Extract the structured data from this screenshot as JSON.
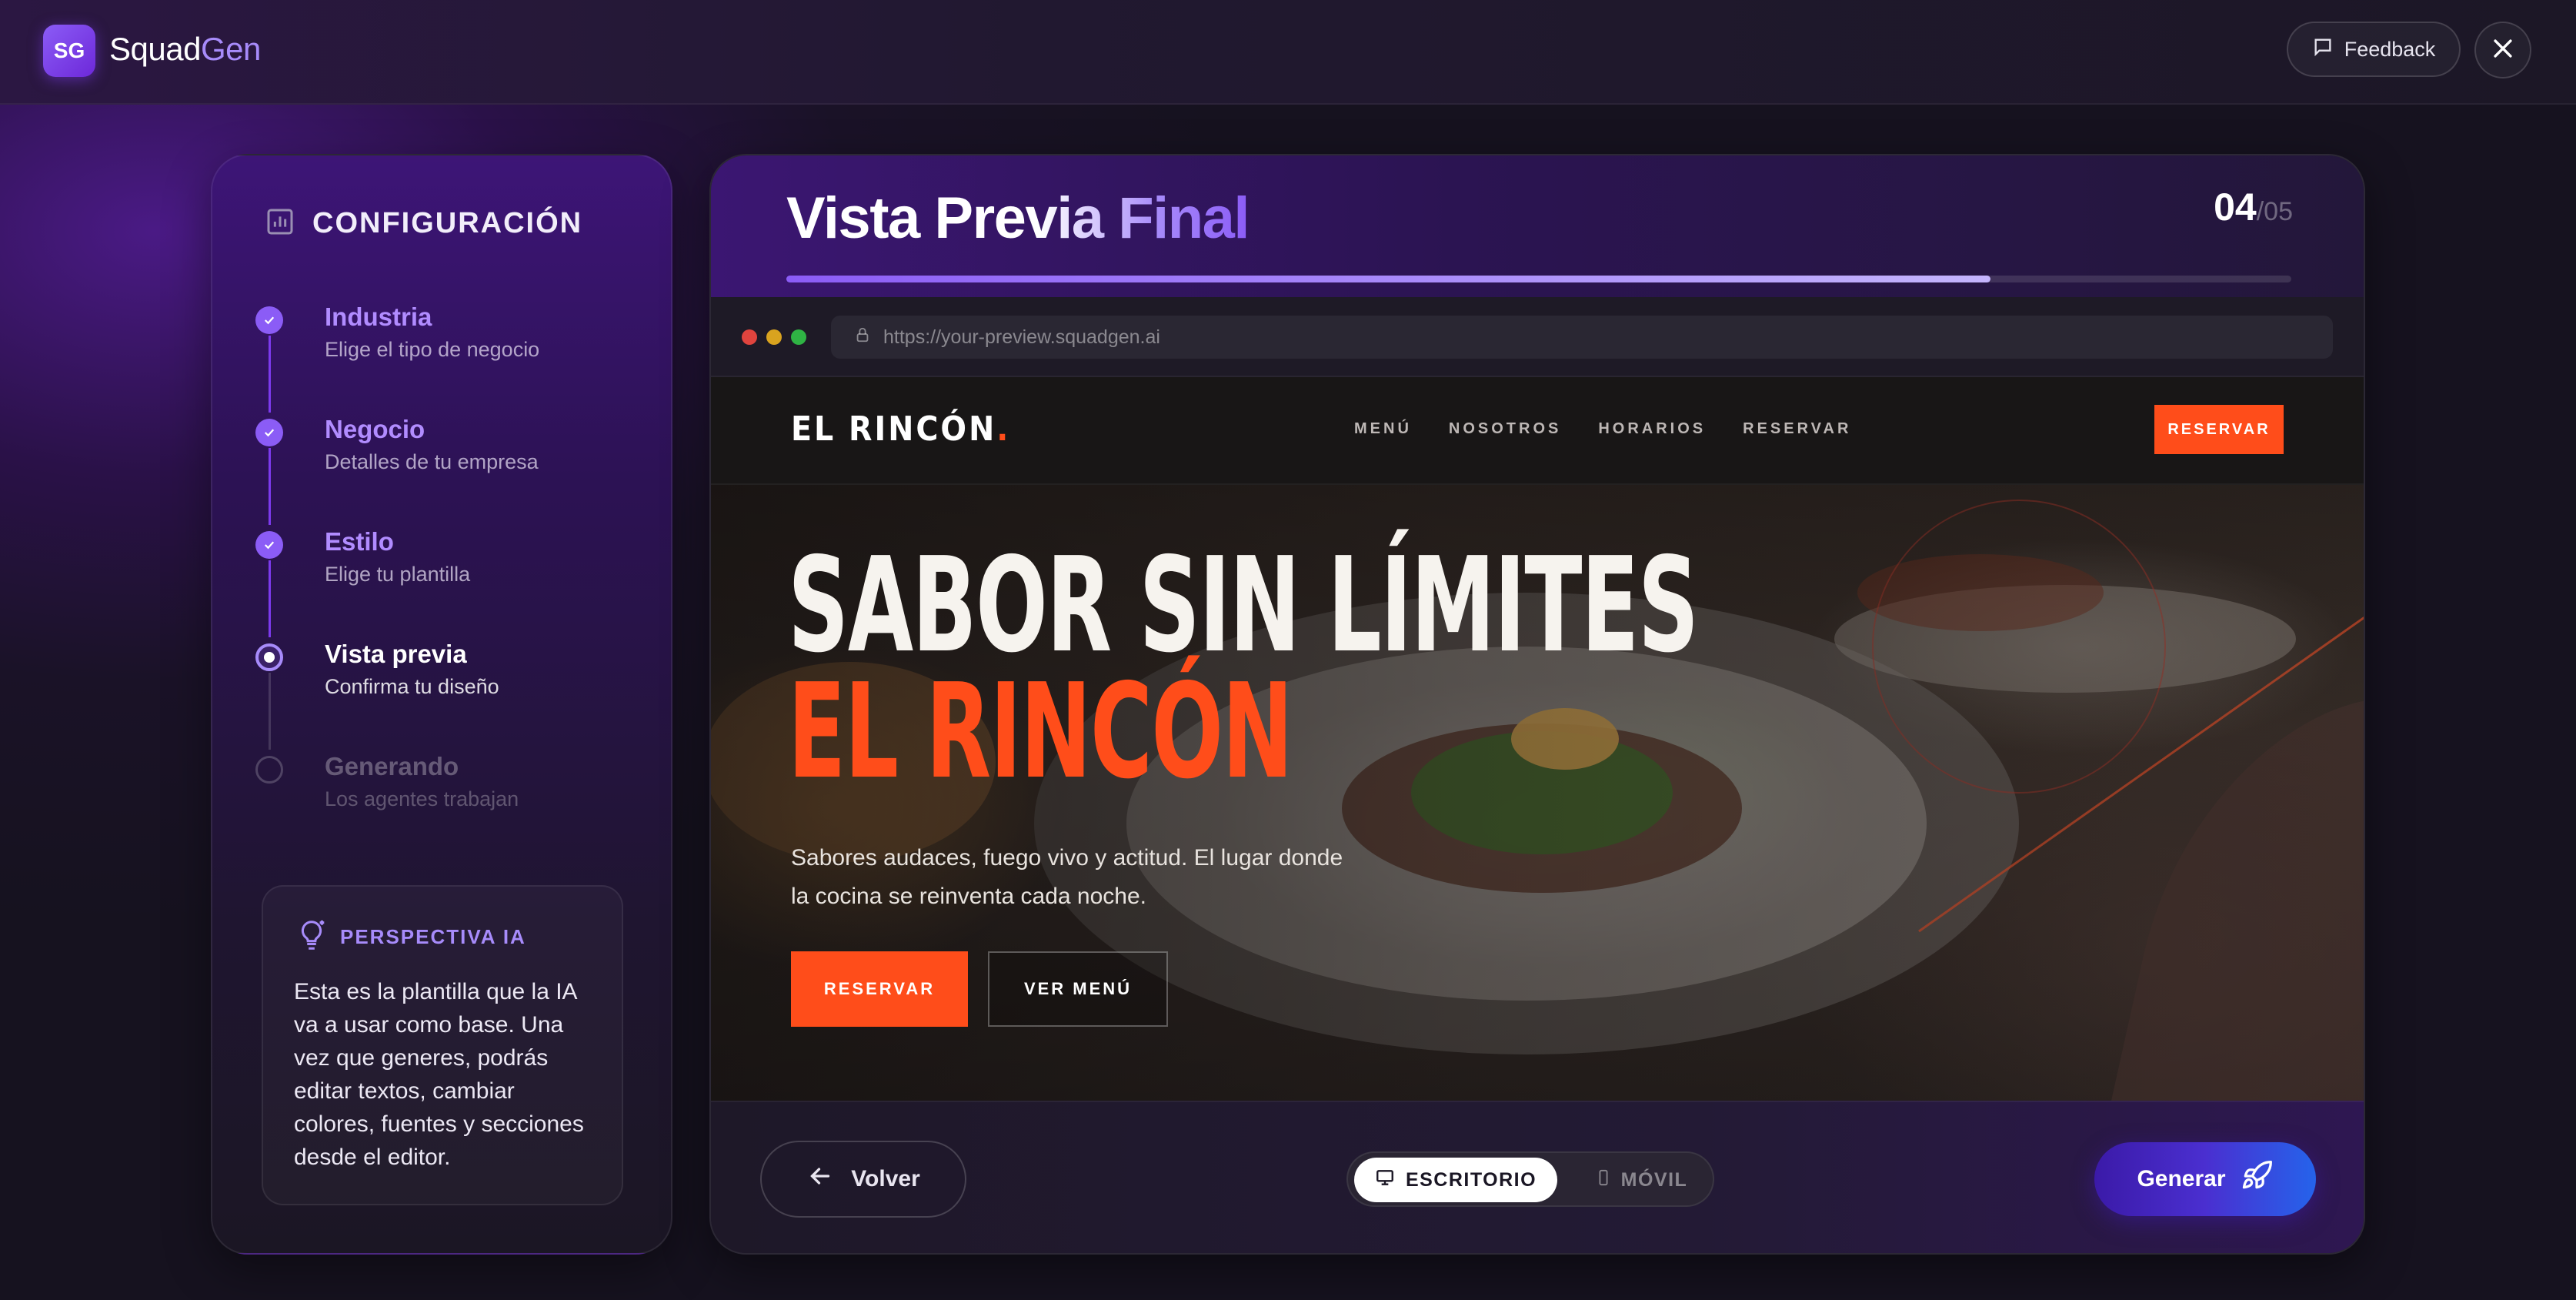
{
  "app": {
    "logo_badge": "SG",
    "brand_part1": "Squad",
    "brand_part2": "Gen",
    "feedback_label": "Feedback"
  },
  "sidebar": {
    "title": "CONFIGURACIÓN",
    "steps": [
      {
        "title": "Industria",
        "subtitle": "Elige el tipo de negocio",
        "state": "done"
      },
      {
        "title": "Negocio",
        "subtitle": "Detalles de tu empresa",
        "state": "done"
      },
      {
        "title": "Estilo",
        "subtitle": "Elige tu plantilla",
        "state": "done"
      },
      {
        "title": "Vista previa",
        "subtitle": "Confirma tu diseño",
        "state": "current"
      },
      {
        "title": "Generando",
        "subtitle": "Los agentes trabajan",
        "state": "pending"
      }
    ],
    "insight": {
      "title": "PERSPECTIVA IA",
      "body": "Esta es la plantilla que la IA va a usar como base. Una vez que generes, podrás editar textos, cambiar colores, fuentes y secciones desde el editor."
    }
  },
  "main": {
    "title": "Vista Previa Final",
    "step_current": "04",
    "step_total": "/05",
    "progress_percent": 80,
    "url": "https://your-preview.squadgen.ai"
  },
  "preview_site": {
    "logo": "EL RINCÓN",
    "logo_dot": ".",
    "nav_links": [
      "MENÚ",
      "NOSOTROS",
      "HORARIOS",
      "RESERVAR"
    ],
    "nav_cta": "RESERVAR",
    "hero_line1": "SABOR SIN LÍMITES",
    "hero_line2": "EL RINCÓN",
    "hero_desc": "Sabores audaces, fuego vivo y actitud. El lugar donde la cocina se reinventa cada noche.",
    "hero_btn_primary": "RESERVAR",
    "hero_btn_secondary": "VER MENÚ"
  },
  "footer": {
    "back_label": "Volver",
    "toggle_desktop": "ESCRITORIO",
    "toggle_mobile": "MÓVIL",
    "generate_label": "Generar"
  },
  "colors": {
    "accent_purple": "#8b5cf6",
    "site_orange": "#ff4d1a",
    "background": "#16121f"
  }
}
